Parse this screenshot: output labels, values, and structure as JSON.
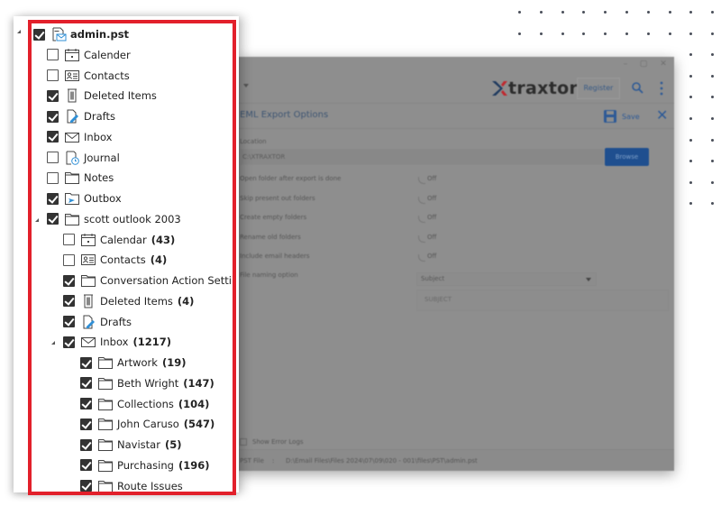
{
  "background_app": {
    "window_controls": [
      "minimize",
      "maximize",
      "close"
    ],
    "brand": {
      "logo_text": "traxtor",
      "logo_mark": "X",
      "mark_colors": [
        "#1f3a5f",
        "#c0282f"
      ]
    },
    "header": {
      "register_label": "Register",
      "search_icon": "search-icon",
      "menu_icon": "kebab-menu-icon"
    },
    "subheader": {
      "title": "EML Export Options",
      "save_label": "Save",
      "close_icon": "close-icon"
    },
    "location": {
      "label": "Location",
      "value": "C:\\XTRAXTOR",
      "browse_label": "Browse"
    },
    "options": [
      {
        "label": "Open folder after export is done",
        "state": "Off"
      },
      {
        "label": "Skip present out folders",
        "state": "Off"
      },
      {
        "label": "Create empty folders",
        "state": "Off"
      },
      {
        "label": "Rename old folders",
        "state": "Off"
      },
      {
        "label": "Include email headers",
        "state": "Off"
      }
    ],
    "file_naming": {
      "label": "File naming option",
      "selected": "Subject",
      "preview": "SUBJECT"
    },
    "show_error_logs_label": "Show Error Logs",
    "status": {
      "key": "PST File",
      "separator": ":",
      "value": "D:\\Email Files\\Files 2024\\07\\09\\020 - 001\\files\\PST\\admin.pst"
    },
    "accent_color": "#1f4f8f"
  },
  "tree": {
    "highlight_color": "#e2202b",
    "nodes": [
      {
        "label": "admin.pst",
        "count": "",
        "checked": true,
        "icon": "pst-file-icon",
        "level": 0,
        "expanded": true,
        "bold": true
      },
      {
        "label": "Calender",
        "count": "",
        "checked": false,
        "icon": "calendar-icon",
        "level": 1
      },
      {
        "label": "Contacts",
        "count": "",
        "checked": false,
        "icon": "contact-card-icon",
        "level": 1
      },
      {
        "label": "Deleted Items",
        "count": "",
        "checked": true,
        "icon": "trash-icon",
        "level": 1
      },
      {
        "label": "Drafts",
        "count": "",
        "checked": true,
        "icon": "draft-icon",
        "level": 1
      },
      {
        "label": "Inbox",
        "count": "",
        "checked": true,
        "icon": "envelope-icon",
        "level": 1
      },
      {
        "label": "Journal",
        "count": "",
        "checked": false,
        "icon": "journal-icon",
        "level": 1
      },
      {
        "label": "Notes",
        "count": "",
        "checked": false,
        "icon": "folder-icon",
        "level": 1
      },
      {
        "label": "Outbox",
        "count": "",
        "checked": true,
        "icon": "outbox-icon",
        "level": 1
      },
      {
        "label": "scott outlook 2003",
        "count": "",
        "checked": true,
        "icon": "folder-icon",
        "level": 1,
        "expanded": true
      },
      {
        "label": "Calendar",
        "count": "(43)",
        "checked": false,
        "icon": "calendar-icon",
        "level": 2
      },
      {
        "label": "Contacts",
        "count": "(4)",
        "checked": false,
        "icon": "contact-card-icon",
        "level": 2
      },
      {
        "label": "Conversation Action Settings",
        "count": "",
        "checked": true,
        "icon": "folder-icon",
        "level": 2
      },
      {
        "label": "Deleted Items",
        "count": "(4)",
        "checked": true,
        "icon": "trash-icon",
        "level": 2
      },
      {
        "label": "Drafts",
        "count": "",
        "checked": true,
        "icon": "draft-icon",
        "level": 2
      },
      {
        "label": "Inbox",
        "count": "(1217)",
        "checked": true,
        "icon": "envelope-icon",
        "level": 2,
        "expanded": true
      },
      {
        "label": "Artwork",
        "count": "(19)",
        "checked": true,
        "icon": "folder-icon",
        "level": 3
      },
      {
        "label": "Beth Wright",
        "count": "(147)",
        "checked": true,
        "icon": "folder-icon",
        "level": 3
      },
      {
        "label": "Collections",
        "count": "(104)",
        "checked": true,
        "icon": "folder-icon",
        "level": 3
      },
      {
        "label": "John Caruso",
        "count": "(547)",
        "checked": true,
        "icon": "folder-icon",
        "level": 3
      },
      {
        "label": "Navistar",
        "count": "(5)",
        "checked": true,
        "icon": "folder-icon",
        "level": 3
      },
      {
        "label": "Purchasing",
        "count": "(196)",
        "checked": true,
        "icon": "folder-icon",
        "level": 3
      },
      {
        "label": "Route Issues",
        "count": "",
        "checked": true,
        "icon": "folder-icon",
        "level": 3
      }
    ]
  }
}
